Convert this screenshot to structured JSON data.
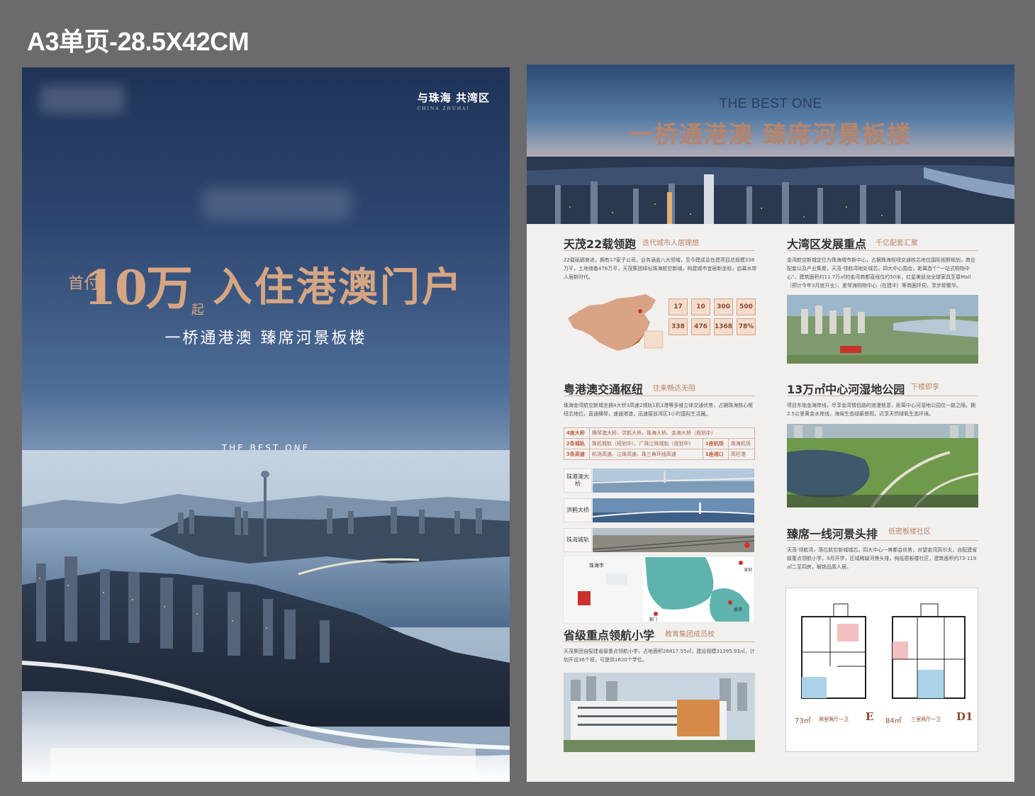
{
  "doc_label": "A3单页-28.5X42CM",
  "front": {
    "brand": "与珠海 共湾区",
    "brand_en": "CHINA ZHUHAI",
    "headline_pre": "首付",
    "headline_num": "10万",
    "headline_qi": "起",
    "headline_main": "入住港澳门户",
    "subline": "一桥通港澳  臻席河景板楼",
    "sub_en": "THE BEST ONE"
  },
  "back": {
    "banner_en": "THE BEST ONE",
    "banner_title": "一桥通港澳 臻席河景板楼",
    "sections": {
      "s1": {
        "title": "天茂22载领跑",
        "tag": "迭代城市人居理想",
        "body": "22载砥砺奋进，拥有17家子公司，业务涵盖八大领域，至今建成及在建项目总规模338万平，土地储备476万平，天茂集团择址珠海航空新城，构建城市宜居新坐标，启幕水岸人居新时代。"
      },
      "s2": {
        "title": "大湾区发展重点",
        "tag": "千亿配套汇聚",
        "body": "金湾航空新城定位为珠海城市新中心，占据珠海枢纽交通核芯地位国际视野规划，商业配套以及产业集聚，天茂·领航湾地处城芯，四大中心围合，距离首个“一站式购物中心”、建筑面积约11.7万㎡的金湾商都直线仅约50米，红星美凯龙全球家具至尊Mall（预计今年3月底开业）、爱琴海购物中心（在建中）等商圈环伺，享步即繁华。"
      },
      "s3": {
        "title": "粤港澳交通枢纽",
        "tag": "往来畅达无阻",
        "body": "珠海金湾航空新城坐拥4大桥3高速2城轨1机1港等多维立体交通优势，占据珠海核心枢纽芯地位，直通横琴，速通港澳，迅速接驳湾区1小时国际生活圈。"
      },
      "s4": {
        "title": "13万㎡中心河湿地公园",
        "tag": "下楼即享",
        "body": "项目东临金海岸线，尽享金湾情侣路的浪漫惬意，距离中心河湿地公园仅一路之隔，拥2.5公里黄金水岸线，海绵生态绿廊景观，近享天然绿氧生态环境。"
      },
      "s5": {
        "title": "臻席一线河景头排",
        "tag": "低密板楼社区",
        "body": "天茂·领航湾，落位航空新城城芯，四大中心一席都会优势，对望金湾高尔夫，自配建省级重点领航小学，9月开学，区域稀缺河景头排，纯低密板楼社区，建筑面积约73-119㎡二至四房，解锁品质人居。"
      },
      "s6": {
        "title": "省级重点领航小学",
        "tag": "教育集团成员校",
        "body": "天茂集团自配建省级重点领航小学，占地面积26817.55㎡，建设规模31395.93㎡，计划开设36个班，可提供1620个学位。"
      }
    },
    "stats": [
      "17",
      "10",
      "300",
      "500",
      "338",
      "476",
      "1368",
      "78%"
    ],
    "traffic_rows": [
      {
        "k1": "4座大桥",
        "v1": "横琴澳大桥、洪鹤大桥、珠海大桥、金海大桥（规划中）"
      },
      {
        "k1": "2条城轨",
        "v1": "珠机城轨（规划中）、广珠江珠城轨（规划中）",
        "k2": "1座机场",
        "v2": "珠海机场"
      },
      {
        "k1": "3条高速",
        "v1": "机场高速、江珠高速、珠三角环线高速",
        "k2": "1座港口",
        "v2": "高栏港"
      }
    ],
    "strips": [
      {
        "label": "珠港澳大桥"
      },
      {
        "label": "洪鹤大桥"
      },
      {
        "label": "珠海城轨"
      }
    ],
    "map_labels": [
      "珠海市",
      "深圳",
      "香港",
      "澳门"
    ],
    "floorplans": [
      {
        "area": "73㎡",
        "desc": "两室两厅一卫",
        "type": "E"
      },
      {
        "area": "84㎡",
        "desc": "三室两厅一卫",
        "type": "D1"
      }
    ]
  },
  "colors": {
    "accent": "#b8846a",
    "gold": "#d6a583",
    "navy": "#2c3d5e"
  }
}
